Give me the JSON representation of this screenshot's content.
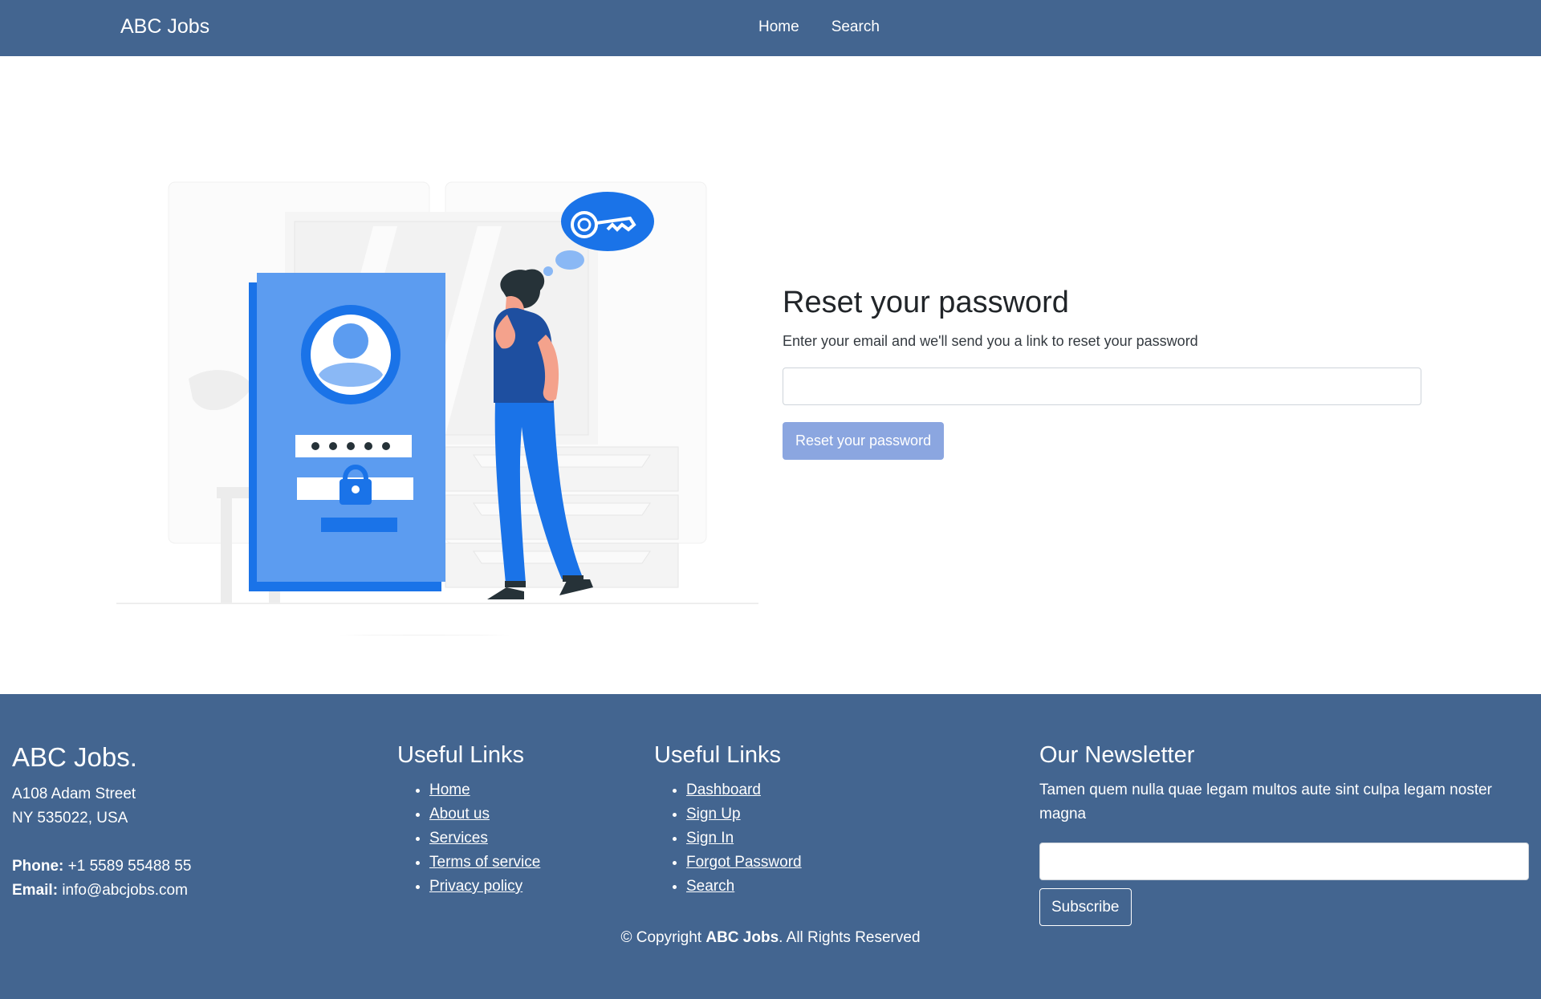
{
  "colors": {
    "primary": "#436590",
    "button_disabled": "#8ba6e0",
    "accent_blue": "#1a73e8"
  },
  "navbar": {
    "brand": "ABC Jobs",
    "links": [
      {
        "label": "Home"
      },
      {
        "label": "Search"
      }
    ]
  },
  "reset": {
    "title": "Reset your password",
    "subtitle": "Enter your email and we'll send you a link to reset your password",
    "email_value": "",
    "email_placeholder": "",
    "submit_label": "Reset your password"
  },
  "illustration": {
    "icon_names": [
      "profile-card",
      "key-thought-bubble",
      "person"
    ]
  },
  "footer": {
    "about": {
      "brand": "ABC Jobs.",
      "address_line1": "A108 Adam Street",
      "address_line2": "NY 535022, USA",
      "phone_label": "Phone:",
      "phone_value": "+1 5589 55488 55",
      "email_label": "Email:",
      "email_value": "info@abcjobs.com"
    },
    "links1": {
      "title": "Useful Links",
      "items": [
        "Home",
        "About us",
        "Services",
        "Terms of service",
        "Privacy policy"
      ]
    },
    "links2": {
      "title": "Useful Links",
      "items": [
        "Dashboard",
        "Sign Up",
        "Sign In",
        "Forgot Password",
        "Search"
      ]
    },
    "newsletter": {
      "title": "Our Newsletter",
      "text": "Tamen quem nulla quae legam multos aute sint culpa legam noster magna",
      "email_value": "",
      "email_placeholder": "",
      "subscribe_label": "Subscribe"
    },
    "copyright": {
      "prefix": "© Copyright ",
      "brand": "ABC Jobs",
      "suffix": ". All Rights Reserved"
    }
  }
}
